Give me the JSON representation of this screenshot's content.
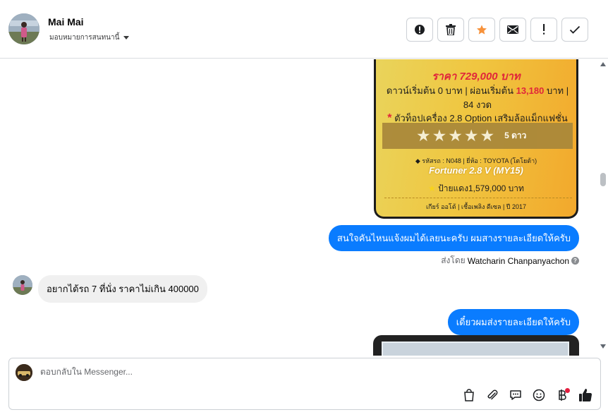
{
  "header": {
    "contact_name": "Mai Mai",
    "assign_label": "มอบหมายการสนทนานี้",
    "actions": [
      {
        "name": "spam-icon",
        "label": "Report"
      },
      {
        "name": "trash-icon",
        "label": "Delete"
      },
      {
        "name": "star-icon",
        "label": "Star"
      },
      {
        "name": "mail-icon",
        "label": "Mark unread"
      },
      {
        "name": "exclamation-icon",
        "label": "Follow up"
      },
      {
        "name": "check-icon",
        "label": "Done"
      }
    ],
    "star_color": "#f7923b"
  },
  "car_card": {
    "price": "ราคา 729,000 บาท",
    "down_payment_pre": "ดาวน์เริ่มต้น 0 บาท | ผ่อนเริ่มต้น",
    "monthly": "13,180",
    "down_payment_post": "บาท |",
    "term": "84 งวด",
    "asterisk": "*",
    "feature": "ตัวท็อปเครื่อง 2.8 Option เสริมล้อแม็กแฟชั่น",
    "stars_glyph": "★",
    "rating_text": "5 ดาว",
    "code_line": "รหัสรถ : N048 | ยี่ห้อ : TOYOTA (โตโยต้า)",
    "model": "Fortuner 2.8 V (MY15)",
    "plate_price": "ป้ายแดง1,579,000 บาท",
    "footer": "เกียร์ ออโต้  |  เชื้อเพลิง ดีเซล  |  ปี 2017"
  },
  "messages": {
    "outgoing_1": "สนใจคันไหนแจ้งผมได้เลยนะครับ ผมสางรายละเอียดให้ครับ",
    "sent_by_prefix": "ส่งโดย",
    "sent_by_name": "Watcharin Chanpanyachon",
    "incoming_1": "อยากได้รถ 7 ที่นั่ง ราคาไม่เกิน 400000",
    "outgoing_2": "เดี๋ยวผมส่งรายละเอียดให้ครับ"
  },
  "composer": {
    "placeholder": "ตอบกลับใน Messenger...",
    "tools": [
      "bag-icon",
      "paperclip-icon",
      "saved-replies-icon",
      "emoji-icon",
      "baht-icon",
      "thumbs-up-icon"
    ]
  },
  "colors": {
    "outgoing_bubble": "#0a7cff",
    "incoming_bubble": "#f0f0f0",
    "accent": "#0a7cff"
  }
}
